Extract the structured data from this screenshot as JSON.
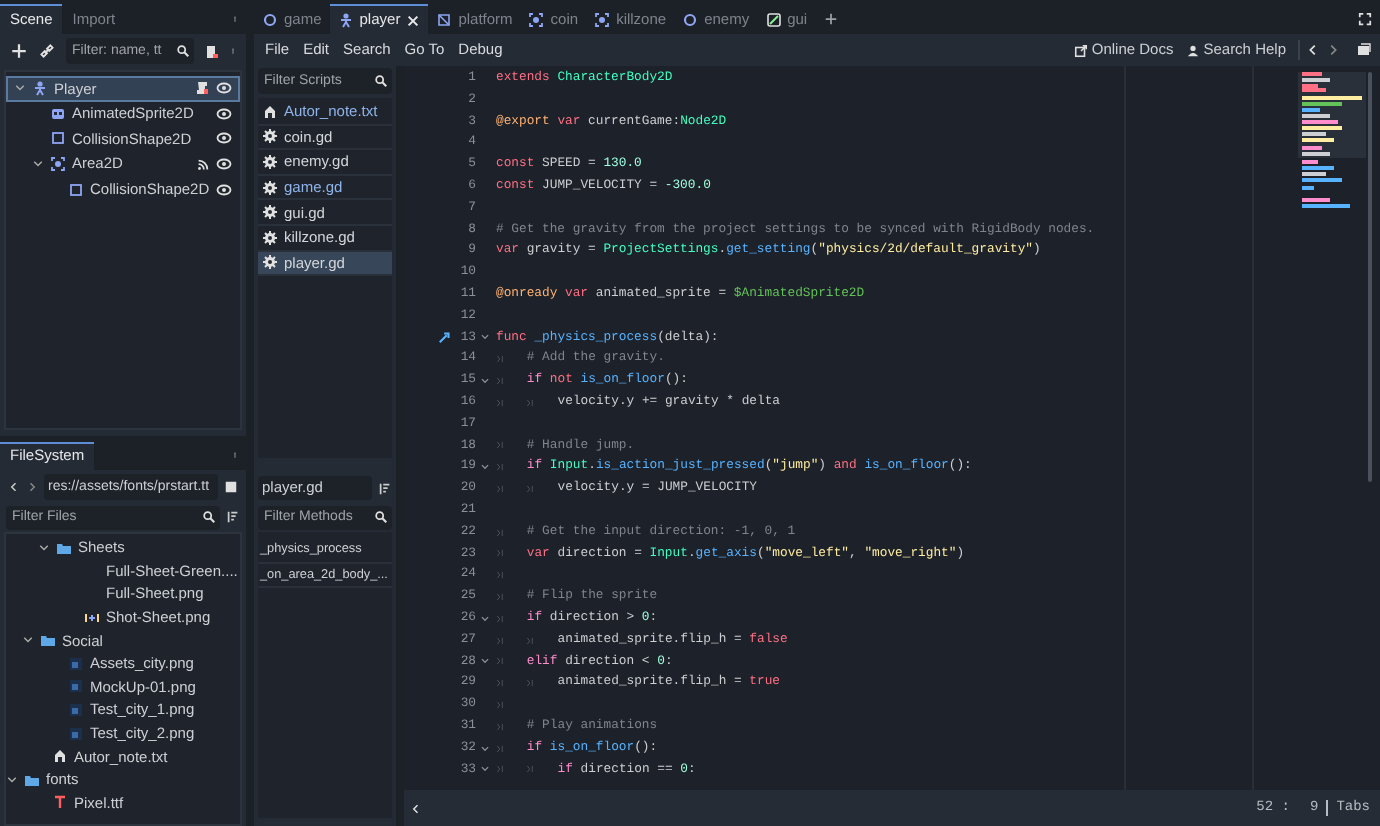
{
  "scene_dock": {
    "tabs": [
      {
        "label": "Scene",
        "selected": true
      },
      {
        "label": "Import",
        "selected": false
      }
    ],
    "filter": {
      "placeholder": "Filter: name, tt"
    },
    "tree": [
      {
        "label": "Player",
        "kind": "body",
        "selected": true,
        "expanded": true,
        "script": true,
        "signals": false,
        "visible": true,
        "children": [
          {
            "label": "AnimatedSprite2D",
            "kind": "sprite",
            "selected": false,
            "script": false,
            "signals": false,
            "visible": true
          },
          {
            "label": "CollisionShape2D",
            "kind": "shape",
            "selected": false,
            "script": false,
            "signals": false,
            "visible": true
          },
          {
            "label": "Area2D",
            "kind": "area",
            "selected": false,
            "expanded": true,
            "script": false,
            "signals": true,
            "visible": true,
            "children": [
              {
                "label": "CollisionShape2D",
                "kind": "shape",
                "selected": false,
                "script": false,
                "signals": false,
                "visible": true
              }
            ]
          }
        ]
      }
    ]
  },
  "filesystem": {
    "title": "FileSystem",
    "path": "res://assets/fonts/prstart.tt",
    "filter": {
      "placeholder": "Filter Files"
    },
    "tree": [
      {
        "kind": "hidden",
        "children": [
          {
            "kind": "hidden",
            "children": [
              {
                "label": "Sheets",
                "kind": "folder",
                "expanded": true,
                "children": [
                  {
                    "label": "Full-Sheet-Green....",
                    "kind": "plain"
                  },
                  {
                    "label": "Full-Sheet.png",
                    "kind": "plain"
                  },
                  {
                    "label": "Shot-Sheet.png",
                    "kind": "animation"
                  }
                ]
              }
            ]
          },
          {
            "label": "Social",
            "kind": "folder",
            "expanded": true,
            "children": [
              {
                "label": "Assets_city.png",
                "kind": "image"
              },
              {
                "label": "MockUp-01.png",
                "kind": "image"
              },
              {
                "label": "Test_city_1.png",
                "kind": "image"
              },
              {
                "label": "Test_city_2.png",
                "kind": "image"
              }
            ]
          },
          {
            "label": "Autor_note.txt",
            "kind": "text"
          }
        ]
      },
      {
        "label": "fonts",
        "kind": "folder",
        "expanded": true,
        "children": [
          {
            "label": "Pixel.ttf",
            "kind": "font"
          }
        ]
      }
    ]
  },
  "editor_tabs": [
    {
      "label": "game",
      "kind": "node",
      "selected": false
    },
    {
      "label": "player",
      "kind": "body",
      "selected": true
    },
    {
      "label": "platform",
      "kind": "scene",
      "selected": false
    },
    {
      "label": "coin",
      "kind": "area",
      "selected": false
    },
    {
      "label": "killzone",
      "kind": "area",
      "selected": false
    },
    {
      "label": "enemy",
      "kind": "node",
      "selected": false
    },
    {
      "label": "gui",
      "kind": "control",
      "selected": false
    }
  ],
  "menu": [
    "File",
    "Edit",
    "Search",
    "Go To",
    "Debug"
  ],
  "help": [
    {
      "label": "Online Docs",
      "kind": "docs"
    },
    {
      "label": "Search Help",
      "kind": "help"
    }
  ],
  "scripts": {
    "filter": {
      "placeholder": "Filter Scripts"
    },
    "items": [
      {
        "label": "Autor_note.txt",
        "kind": "text",
        "accent": true,
        "selected": false
      },
      {
        "label": "coin.gd",
        "kind": "script",
        "accent": false,
        "selected": false
      },
      {
        "label": "enemy.gd",
        "kind": "script",
        "accent": false,
        "selected": false
      },
      {
        "label": "game.gd",
        "kind": "script",
        "accent": true,
        "selected": false
      },
      {
        "label": "gui.gd",
        "kind": "script",
        "accent": false,
        "selected": false
      },
      {
        "label": "killzone.gd",
        "kind": "script",
        "accent": false,
        "selected": false
      },
      {
        "label": "player.gd",
        "kind": "script",
        "accent": false,
        "selected": true
      }
    ]
  },
  "methods": {
    "current": "player.gd",
    "filter": {
      "placeholder": "Filter Methods"
    },
    "items": [
      "_physics_process",
      "_on_area_2d_body_..."
    ]
  },
  "code": [
    {
      "number": "1",
      "foldable": false,
      "connected": false,
      "segments": [
        {
          "kind": "kw",
          "text": "extends "
        },
        {
          "kind": "type",
          "text": "CharacterBody2D"
        }
      ]
    },
    {
      "number": "2",
      "foldable": false,
      "connected": false
    },
    {
      "number": "3",
      "foldable": false,
      "connected": false,
      "segments": [
        {
          "kind": "annotation",
          "text": "@export "
        },
        {
          "kind": "kw",
          "text": "var"
        },
        {
          "kind": "plain",
          "text": " currentGame:"
        },
        {
          "kind": "type",
          "text": "Node2D"
        }
      ]
    },
    {
      "number": "4",
      "foldable": false,
      "connected": false
    },
    {
      "number": "5",
      "foldable": false,
      "connected": false,
      "segments": [
        {
          "kind": "kw",
          "text": "const"
        },
        {
          "kind": "plain",
          "text": " SPEED = "
        },
        {
          "kind": "number",
          "text": "130.0"
        }
      ]
    },
    {
      "number": "6",
      "foldable": false,
      "connected": false,
      "segments": [
        {
          "kind": "kw",
          "text": "const"
        },
        {
          "kind": "plain",
          "text": " JUMP_VELOCITY = "
        },
        {
          "kind": "number",
          "text": "-300.0"
        }
      ]
    },
    {
      "number": "7",
      "foldable": false,
      "connected": false
    },
    {
      "number": "8",
      "foldable": false,
      "connected": false,
      "segments": [
        {
          "kind": "comment",
          "text": "# Get the gravity from the project settings to be synced with RigidBody nodes."
        }
      ]
    },
    {
      "number": "9",
      "foldable": false,
      "connected": false,
      "segments": [
        {
          "kind": "kw",
          "text": "var"
        },
        {
          "kind": "plain",
          "text": " gravity = "
        },
        {
          "kind": "type",
          "text": "ProjectSettings"
        },
        {
          "kind": "plain",
          "text": "."
        },
        {
          "kind": "func",
          "text": "get_setting"
        },
        {
          "kind": "plain",
          "text": "("
        },
        {
          "kind": "string",
          "text": "\"physics/2d/default_gravity\""
        },
        {
          "kind": "plain",
          "text": ")"
        }
      ]
    },
    {
      "number": "10",
      "foldable": false,
      "connected": false
    },
    {
      "number": "11",
      "foldable": false,
      "connected": false,
      "segments": [
        {
          "kind": "annotation",
          "text": "@onready "
        },
        {
          "kind": "kw",
          "text": "var"
        },
        {
          "kind": "plain",
          "text": " animated_sprite = "
        },
        {
          "kind": "nodepath",
          "text": "$AnimatedSprite2D"
        }
      ]
    },
    {
      "number": "12",
      "foldable": false,
      "connected": false
    },
    {
      "number": "13",
      "foldable": true,
      "connected": true,
      "segments": [
        {
          "kind": "kw",
          "text": "func "
        },
        {
          "kind": "func",
          "text": "_physics_process"
        },
        {
          "kind": "plain",
          "text": "(delta):"
        }
      ]
    },
    {
      "number": "14",
      "foldable": false,
      "connected": false,
      "segments": [
        {
          "kind": "comment",
          "text": "\t# Add the gravity."
        }
      ]
    },
    {
      "number": "15",
      "foldable": true,
      "connected": false,
      "segments": [
        {
          "kind": "control",
          "text": "\tif "
        },
        {
          "kind": "kw",
          "text": "not "
        },
        {
          "kind": "func",
          "text": "is_on_floor"
        },
        {
          "kind": "plain",
          "text": "():"
        }
      ]
    },
    {
      "number": "16",
      "foldable": false,
      "connected": false,
      "segments": [
        {
          "kind": "plain",
          "text": "\t\tvelocity.y += gravity * delta"
        }
      ]
    },
    {
      "number": "17",
      "foldable": false,
      "connected": false
    },
    {
      "number": "18",
      "foldable": false,
      "connected": false,
      "segments": [
        {
          "kind": "comment",
          "text": "\t# Handle jump."
        }
      ]
    },
    {
      "number": "19",
      "foldable": true,
      "connected": false,
      "segments": [
        {
          "kind": "control",
          "text": "\tif "
        },
        {
          "kind": "type",
          "text": "Input"
        },
        {
          "kind": "plain",
          "text": "."
        },
        {
          "kind": "func",
          "text": "is_action_just_pressed"
        },
        {
          "kind": "plain",
          "text": "("
        },
        {
          "kind": "string",
          "text": "\"jump\""
        },
        {
          "kind": "plain",
          "text": ") "
        },
        {
          "kind": "kw",
          "text": "and "
        },
        {
          "kind": "func",
          "text": "is_on_floor"
        },
        {
          "kind": "plain",
          "text": "():"
        }
      ]
    },
    {
      "number": "20",
      "foldable": false,
      "connected": false,
      "segments": [
        {
          "kind": "plain",
          "text": "\t\tvelocity.y = JUMP_VELOCITY"
        }
      ]
    },
    {
      "number": "21",
      "foldable": false,
      "connected": false
    },
    {
      "number": "22",
      "foldable": false,
      "connected": false,
      "segments": [
        {
          "kind": "comment",
          "text": "\t# Get the input direction: -1, 0, 1"
        }
      ]
    },
    {
      "number": "23",
      "foldable": false,
      "connected": false,
      "segments": [
        {
          "kind": "kw",
          "text": "\tvar"
        },
        {
          "kind": "plain",
          "text": " direction = "
        },
        {
          "kind": "type",
          "text": "Input"
        },
        {
          "kind": "plain",
          "text": "."
        },
        {
          "kind": "func",
          "text": "get_axis"
        },
        {
          "kind": "plain",
          "text": "("
        },
        {
          "kind": "string",
          "text": "\"move_left\""
        },
        {
          "kind": "plain",
          "text": ", "
        },
        {
          "kind": "string",
          "text": "\"move_right\""
        },
        {
          "kind": "plain",
          "text": ")"
        }
      ]
    },
    {
      "number": "24",
      "foldable": false,
      "connected": false,
      "indent_marker": true
    },
    {
      "number": "25",
      "foldable": false,
      "connected": false,
      "segments": [
        {
          "kind": "comment",
          "text": "\t# Flip the sprite"
        }
      ]
    },
    {
      "number": "26",
      "foldable": true,
      "connected": false,
      "segments": [
        {
          "kind": "control",
          "text": "\tif"
        },
        {
          "kind": "plain",
          "text": " direction > "
        },
        {
          "kind": "number",
          "text": "0"
        },
        {
          "kind": "plain",
          "text": ":"
        }
      ]
    },
    {
      "number": "27",
      "foldable": false,
      "connected": false,
      "segments": [
        {
          "kind": "plain",
          "text": "\t\tanimated_sprite.flip_h = "
        },
        {
          "kind": "kw",
          "text": "false"
        }
      ]
    },
    {
      "number": "28",
      "foldable": true,
      "connected": false,
      "segments": [
        {
          "kind": "control",
          "text": "\telif"
        },
        {
          "kind": "plain",
          "text": " direction < "
        },
        {
          "kind": "number",
          "text": "0"
        },
        {
          "kind": "plain",
          "text": ":"
        }
      ]
    },
    {
      "number": "29",
      "foldable": false,
      "connected": false,
      "segments": [
        {
          "kind": "plain",
          "text": "\t\tanimated_sprite.flip_h = "
        },
        {
          "kind": "kw",
          "text": "true"
        }
      ]
    },
    {
      "number": "30",
      "foldable": false,
      "connected": false,
      "indent_marker": true
    },
    {
      "number": "31",
      "foldable": false,
      "connected": false,
      "segments": [
        {
          "kind": "comment",
          "text": "\t# Play animations"
        }
      ]
    },
    {
      "number": "32",
      "foldable": true,
      "connected": false,
      "segments": [
        {
          "kind": "control",
          "text": "\tif "
        },
        {
          "kind": "func",
          "text": "is_on_floor"
        },
        {
          "kind": "plain",
          "text": "():"
        }
      ]
    },
    {
      "number": "33",
      "foldable": true,
      "connected": false,
      "segments": [
        {
          "kind": "control",
          "text": "\t\tif"
        },
        {
          "kind": "plain",
          "text": " direction == "
        },
        {
          "kind": "number",
          "text": "0"
        },
        {
          "kind": "plain",
          "text": ":"
        }
      ]
    }
  ],
  "status_bar": {
    "line": "52 :",
    "column": "9",
    "indent": "Tabs"
  }
}
